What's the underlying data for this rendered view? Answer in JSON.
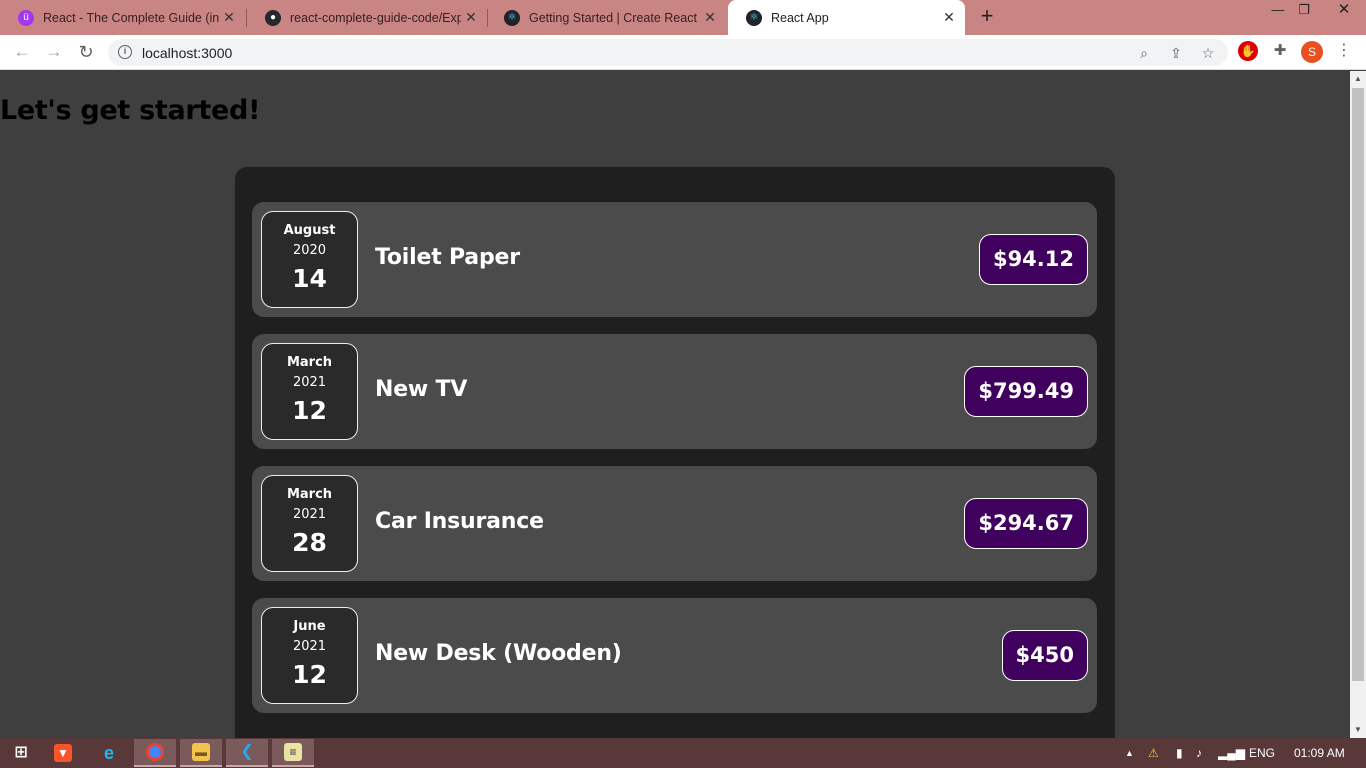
{
  "browser": {
    "tabs": [
      {
        "title": "React - The Complete Guide (incl",
        "icon": "udemy-icon",
        "color": "#a435f0"
      },
      {
        "title": "react-complete-guide-code/Expe",
        "icon": "github-icon",
        "color": "#24292f"
      },
      {
        "title": "Getting Started | Create React Ap",
        "icon": "react-icon",
        "color": "#20232a"
      },
      {
        "title": "React App",
        "icon": "react-icon",
        "color": "#20232a"
      }
    ],
    "active_tab": 3,
    "url": "localhost:3000"
  },
  "page": {
    "heading": "Let's get started!",
    "expenses": [
      {
        "month": "August",
        "year": "2020",
        "day": "14",
        "title": "Toilet Paper",
        "amount": "$94.12"
      },
      {
        "month": "March",
        "year": "2021",
        "day": "12",
        "title": "New TV",
        "amount": "$799.49"
      },
      {
        "month": "March",
        "year": "2021",
        "day": "28",
        "title": "Car Insurance",
        "amount": "$294.67"
      },
      {
        "month": "June",
        "year": "2021",
        "day": "12",
        "title": "New Desk (Wooden)",
        "amount": "$450"
      }
    ],
    "colors": {
      "page_bg": "#3f3f3f",
      "list_bg": "#1f1f1f",
      "item_bg": "#4b4b4b",
      "price_bg": "#40005d"
    }
  },
  "taskbar": {
    "apps": [
      "windows-start-icon",
      "brave-icon",
      "internet-explorer-icon",
      "chrome-icon",
      "file-explorer-icon",
      "vscode-icon",
      "notepad-icon"
    ],
    "language": "ENG",
    "time": "01:09 AM"
  }
}
